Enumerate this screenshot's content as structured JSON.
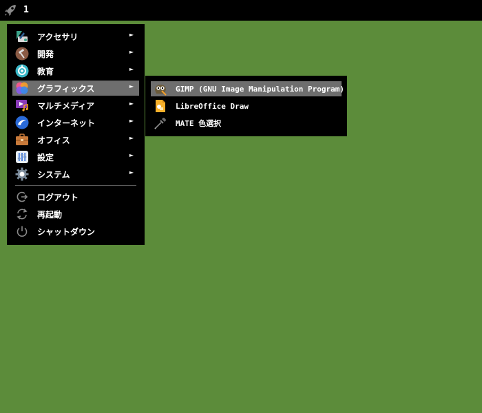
{
  "panel": {
    "launcher_icon": "rocket-icon",
    "workspace": "1"
  },
  "main_menu": {
    "items": [
      {
        "label": "アクセサリ",
        "icon": "accessories-icon",
        "submenu": true
      },
      {
        "label": "開発",
        "icon": "development-icon",
        "submenu": true
      },
      {
        "label": "教育",
        "icon": "education-icon",
        "submenu": true
      },
      {
        "label": "グラフィックス",
        "icon": "graphics-icon",
        "submenu": true,
        "highlighted": true
      },
      {
        "label": "マルチメディア",
        "icon": "multimedia-icon",
        "submenu": true
      },
      {
        "label": "インターネット",
        "icon": "internet-icon",
        "submenu": true
      },
      {
        "label": "オフィス",
        "icon": "office-icon",
        "submenu": true
      },
      {
        "label": "設定",
        "icon": "settings-icon",
        "submenu": true
      },
      {
        "label": "システム",
        "icon": "system-icon",
        "submenu": true
      }
    ],
    "session": [
      {
        "label": "ログアウト",
        "icon": "logout-icon"
      },
      {
        "label": "再起動",
        "icon": "restart-icon"
      },
      {
        "label": "シャットダウン",
        "icon": "shutdown-icon"
      }
    ],
    "arrow": "►"
  },
  "graphics_submenu": {
    "items": [
      {
        "label": "GIMP (GNU Image Manipulation Program)",
        "icon": "gimp-icon",
        "highlighted": true
      },
      {
        "label": "LibreOffice Draw",
        "icon": "libreoffice-draw-icon"
      },
      {
        "label": "MATE 色選択",
        "icon": "color-picker-icon"
      }
    ]
  },
  "colors": {
    "desktop": "#5c8c3a",
    "menu_bg": "#000000",
    "highlight": "#6e6e6e"
  }
}
